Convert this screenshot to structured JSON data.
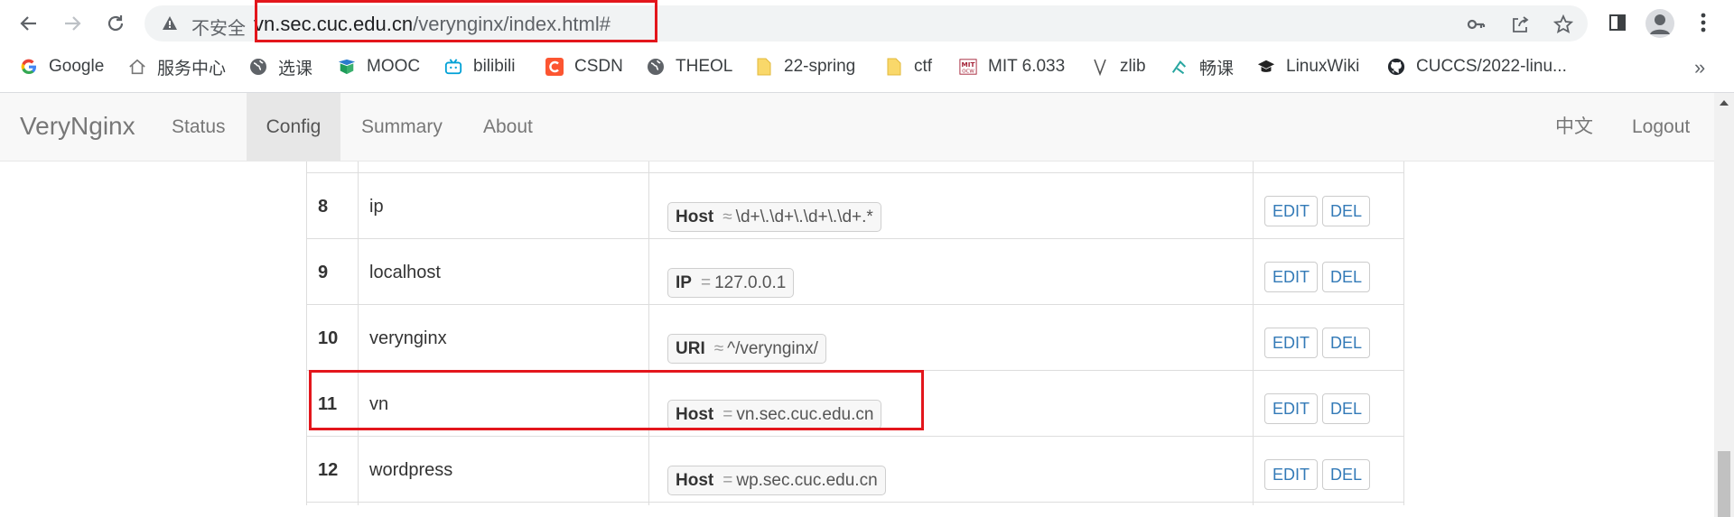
{
  "browser": {
    "security_label": "不安全",
    "url_host": "vn.sec.cuc.edu.cn",
    "url_path": "/verynginx/index.html#",
    "bookmarks": [
      {
        "label": "Google",
        "icon": "google-icon"
      },
      {
        "label": "服务中心",
        "icon": "home-icon"
      },
      {
        "label": "选课",
        "icon": "globe-icon"
      },
      {
        "label": "MOOC",
        "icon": "mooc-icon"
      },
      {
        "label": "bilibili",
        "icon": "bilibili-icon"
      },
      {
        "label": "CSDN",
        "icon": "csdn-icon"
      },
      {
        "label": "THEOL",
        "icon": "globe-icon"
      },
      {
        "label": "22-spring",
        "icon": "folder-icon"
      },
      {
        "label": "ctf",
        "icon": "folder-icon"
      },
      {
        "label": "MIT 6.033",
        "icon": "mit-icon"
      },
      {
        "label": "zlib",
        "icon": "zlib-icon"
      },
      {
        "label": "畅课",
        "icon": "changke-icon"
      },
      {
        "label": "LinuxWiki",
        "icon": "graduation-cap-icon"
      },
      {
        "label": "CUCCS/2022-linu...",
        "icon": "github-icon"
      }
    ],
    "more_bookmarks": "»"
  },
  "app": {
    "brand": "VeryNginx",
    "nav": [
      {
        "label": "Status",
        "active": false
      },
      {
        "label": "Config",
        "active": true
      },
      {
        "label": "Summary",
        "active": false
      },
      {
        "label": "About",
        "active": false
      }
    ],
    "lang": "中文",
    "logout": "Logout"
  },
  "matcher_table": {
    "rows": [
      {
        "num": "8",
        "name": "ip",
        "key": "Host",
        "op": "≈",
        "value": "\\d+\\.\\d+\\.\\d+\\.\\d+.*",
        "edit": "EDIT",
        "del": "DEL"
      },
      {
        "num": "9",
        "name": "localhost",
        "key": "IP",
        "op": "=",
        "value": "127.0.0.1",
        "edit": "EDIT",
        "del": "DEL"
      },
      {
        "num": "10",
        "name": "verynginx",
        "key": "URI",
        "op": "≈",
        "value": "^/verynginx/",
        "edit": "EDIT",
        "del": "DEL"
      },
      {
        "num": "11",
        "name": "vn",
        "key": "Host",
        "op": "=",
        "value": "vn.sec.cuc.edu.cn",
        "edit": "EDIT",
        "del": "DEL"
      },
      {
        "num": "12",
        "name": "wordpress",
        "key": "Host",
        "op": "=",
        "value": "wp.sec.cuc.edu.cn",
        "edit": "EDIT",
        "del": "DEL"
      }
    ]
  },
  "colors": {
    "highlight_box": "#e3161c",
    "link": "#337ab7"
  }
}
